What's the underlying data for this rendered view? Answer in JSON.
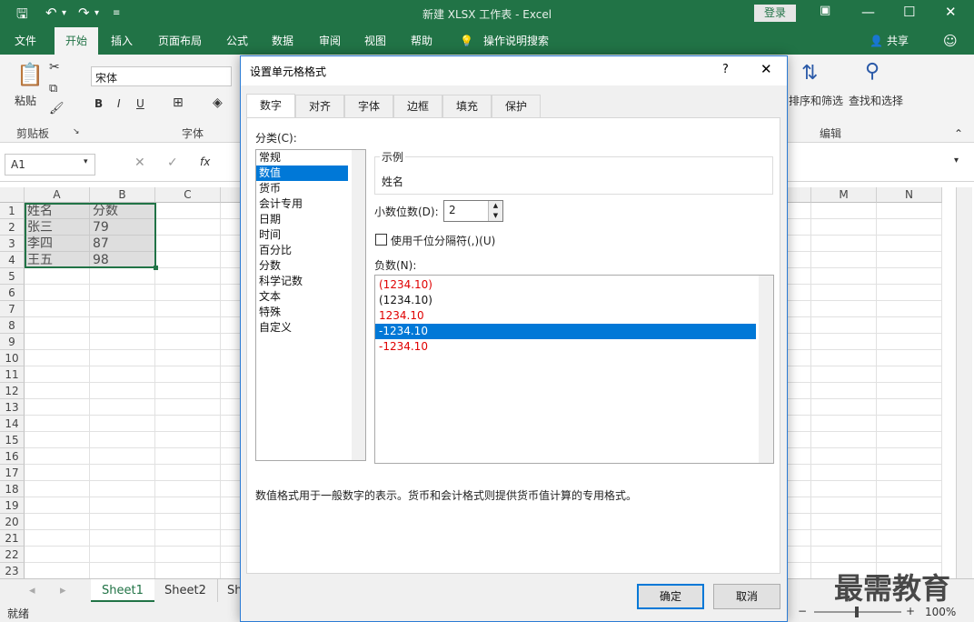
{
  "titlebar": {
    "title": "新建 XLSX 工作表 - Excel",
    "login": "登录"
  },
  "tabs": [
    "文件",
    "开始",
    "插入",
    "页面布局",
    "公式",
    "数据",
    "审阅",
    "视图",
    "帮助"
  ],
  "tell_me": "操作说明搜索",
  "share": "共享",
  "ribbon": {
    "paste": "粘贴",
    "clipboard": "剪贴板",
    "font_name": "宋体",
    "font_group": "字体",
    "sort_filter": "排序和筛选",
    "find_select": "查找和选择",
    "editing": "编辑",
    "bold": "B",
    "italic": "I",
    "underline": "U"
  },
  "namebox": "A1",
  "fx": "fx",
  "columns": [
    "A",
    "B",
    "C",
    "M",
    "N"
  ],
  "rows": [
    "1",
    "2",
    "3",
    "4",
    "5",
    "6",
    "7",
    "8",
    "9",
    "10",
    "11",
    "12",
    "13",
    "14",
    "15",
    "16",
    "17",
    "18",
    "19",
    "20",
    "21",
    "22",
    "23"
  ],
  "cells": [
    [
      "姓名",
      "分数"
    ],
    [
      "张三",
      "79"
    ],
    [
      "李四",
      "87"
    ],
    [
      "王五",
      "98"
    ]
  ],
  "sheets": [
    "Sheet1",
    "Sheet2",
    "Sh"
  ],
  "status": {
    "ready": "就绪",
    "zoom": "100%"
  },
  "watermark": "最需教育",
  "dialog": {
    "title": "设置单元格格式",
    "help": "?",
    "tabs": [
      "数字",
      "对齐",
      "字体",
      "边框",
      "填充",
      "保护"
    ],
    "category_label": "分类(C):",
    "categories": [
      "常规",
      "数值",
      "货币",
      "会计专用",
      "日期",
      "时间",
      "百分比",
      "分数",
      "科学记数",
      "文本",
      "特殊",
      "自定义"
    ],
    "sample_label": "示例",
    "sample_value": "姓名",
    "decimal_label": "小数位数(D):",
    "decimal_value": "2",
    "thousands_label": "使用千位分隔符(,)(U)",
    "negative_label": "负数(N):",
    "negatives": [
      "(1234.10)",
      "(1234.10)",
      "1234.10",
      "-1234.10",
      "-1234.10"
    ],
    "negative_colors": [
      "#e00000",
      "#111111",
      "#e00000",
      "#ffffff",
      "#e00000"
    ],
    "description": "数值格式用于一般数字的表示。货币和会计格式则提供货币值计算的专用格式。",
    "ok": "确定",
    "cancel": "取消"
  }
}
